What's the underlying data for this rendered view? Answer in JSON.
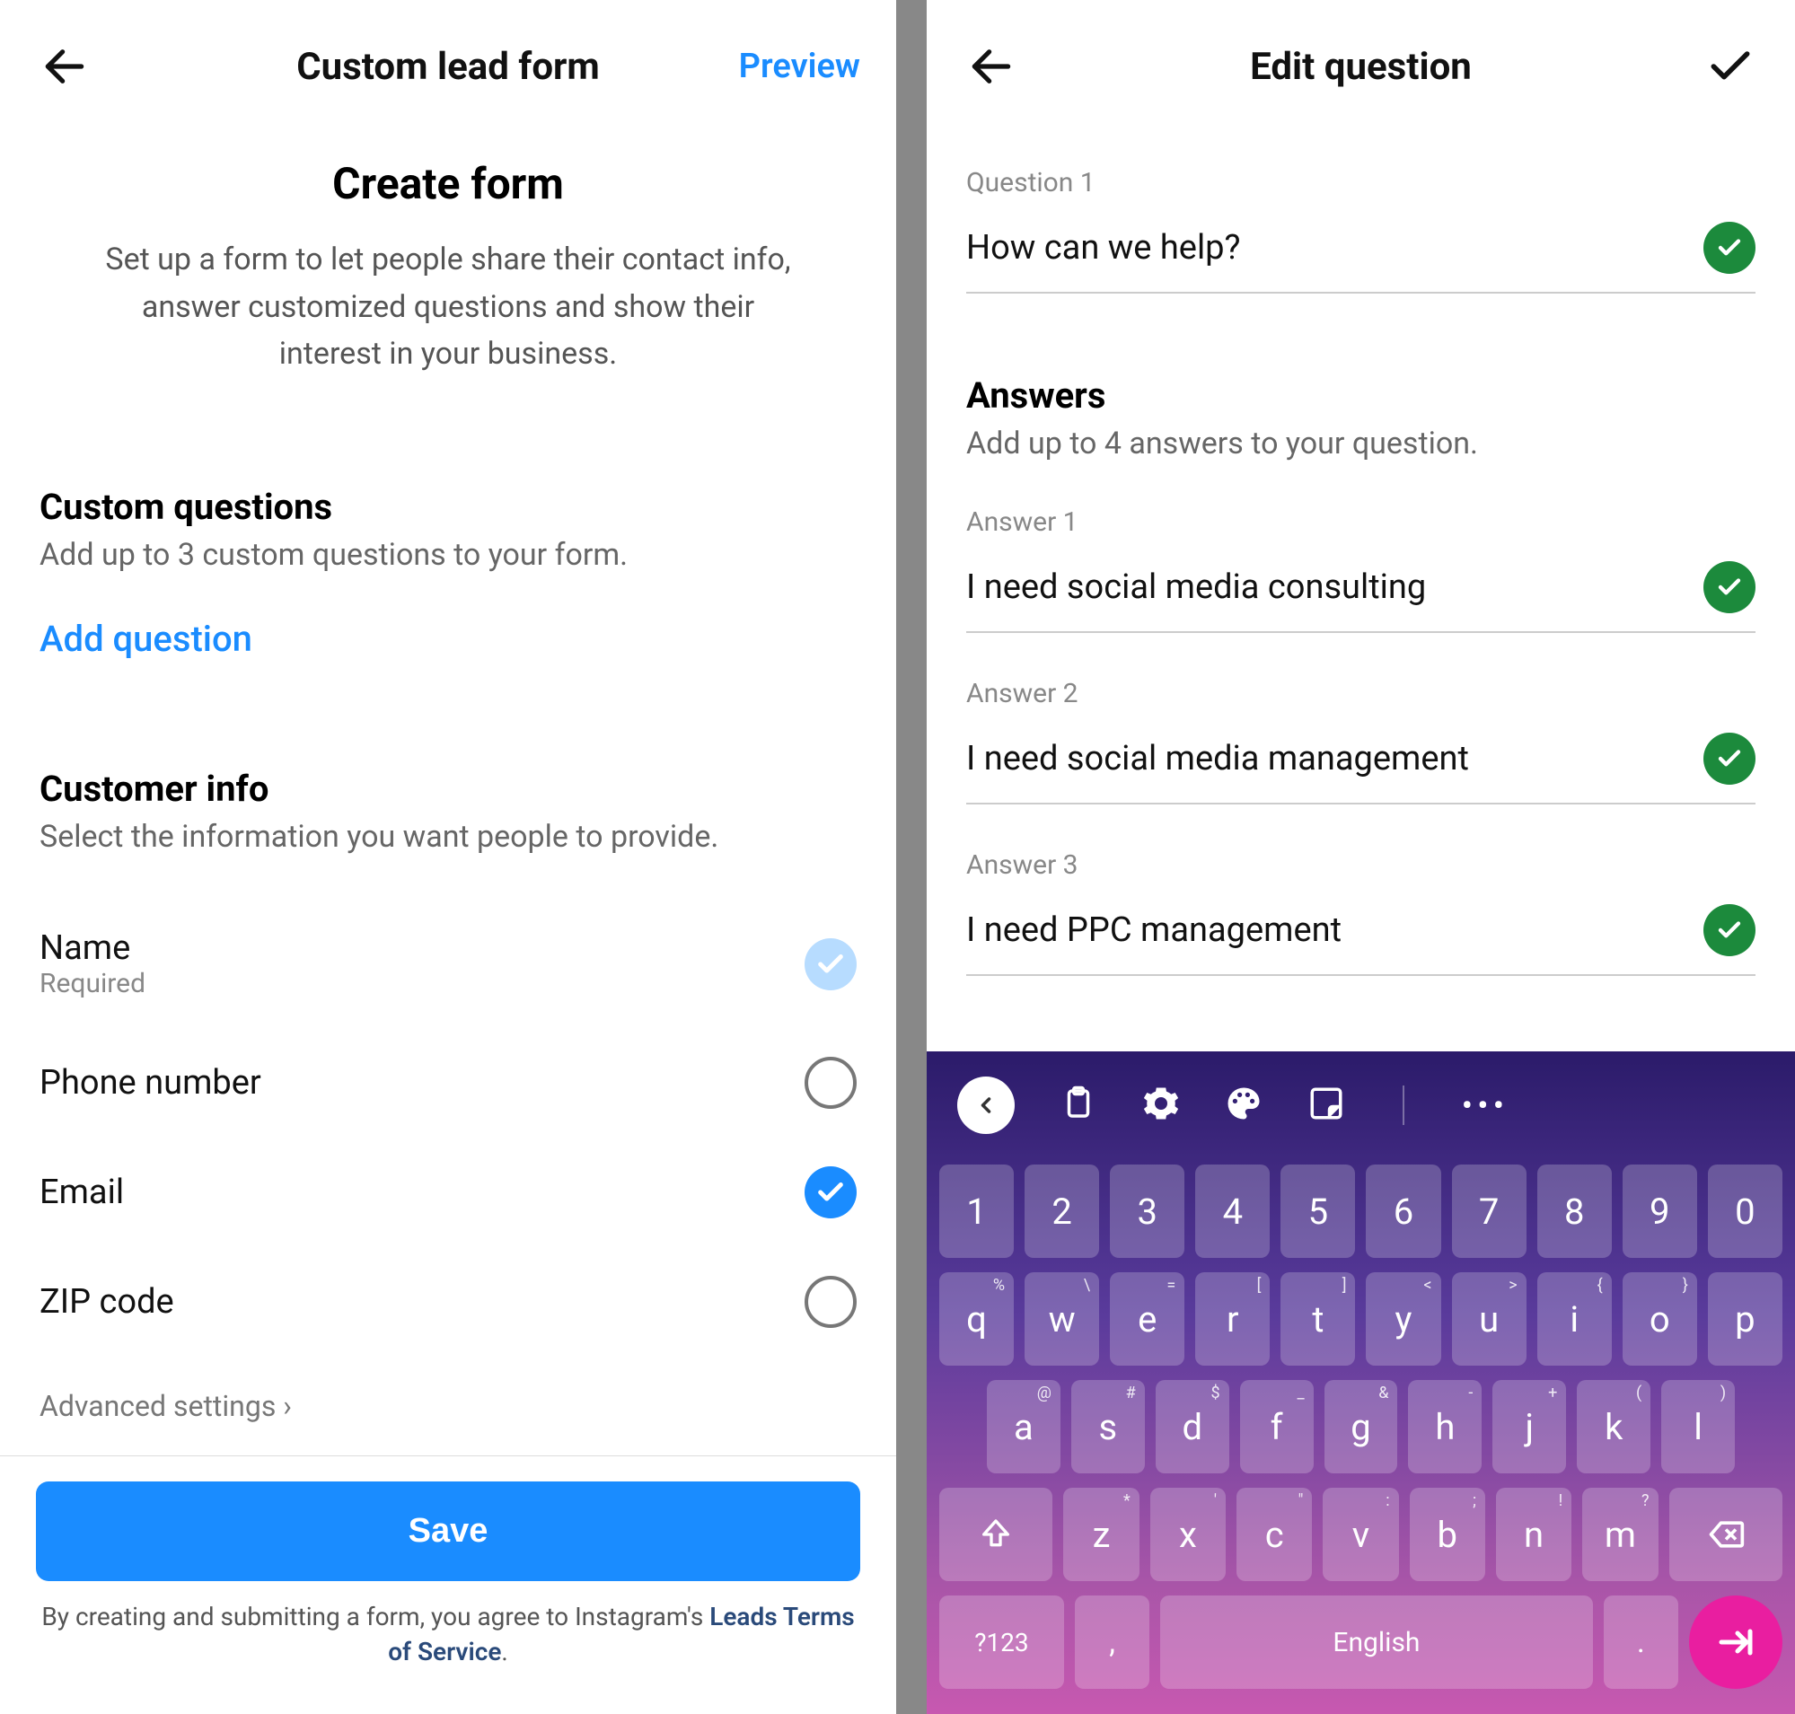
{
  "left": {
    "header": {
      "title": "Custom lead form",
      "preview": "Preview"
    },
    "main_title": "Create form",
    "subtitle": "Set up a form to let people share their contact info, answer customized questions and show their interest in your business.",
    "custom_q_title": "Custom questions",
    "custom_q_sub": "Add up to 3 custom questions to your form.",
    "add_question": "Add question",
    "customer_info_title": "Customer info",
    "customer_info_sub": "Select the information you want people to provide.",
    "fields": {
      "name": {
        "label": "Name",
        "sub": "Required"
      },
      "phone": {
        "label": "Phone number"
      },
      "email": {
        "label": "Email"
      },
      "zip": {
        "label": "ZIP code"
      }
    },
    "advanced": "Advanced settings",
    "save": "Save",
    "legal_pre": "By creating and submitting a form, you agree to Instagram's ",
    "legal_link": "Leads Terms of Service",
    "legal_post": "."
  },
  "right": {
    "header": {
      "title": "Edit question"
    },
    "q1_label": "Question 1",
    "q1_value": "How can we help?",
    "answers_title": "Answers",
    "answers_sub": "Add up to 4 answers to your question.",
    "a1_label": "Answer 1",
    "a1_value": "I need social media consulting",
    "a2_label": "Answer 2",
    "a2_value": "I need social media management",
    "a3_label": "Answer 3",
    "a3_value": "I need PPC management",
    "keyboard": {
      "row1": [
        "1",
        "2",
        "3",
        "4",
        "5",
        "6",
        "7",
        "8",
        "9",
        "0"
      ],
      "row2": [
        {
          "k": "q",
          "s": "%"
        },
        {
          "k": "w",
          "s": "\\"
        },
        {
          "k": "e",
          "s": "="
        },
        {
          "k": "r",
          "s": "["
        },
        {
          "k": "t",
          "s": "]"
        },
        {
          "k": "y",
          "s": "<"
        },
        {
          "k": "u",
          "s": ">"
        },
        {
          "k": "i",
          "s": "{"
        },
        {
          "k": "o",
          "s": "}"
        },
        {
          "k": "p",
          "s": ""
        }
      ],
      "row3": [
        {
          "k": "a",
          "s": "@"
        },
        {
          "k": "s",
          "s": "#"
        },
        {
          "k": "d",
          "s": "$"
        },
        {
          "k": "f",
          "s": "_"
        },
        {
          "k": "g",
          "s": "&"
        },
        {
          "k": "h",
          "s": "-"
        },
        {
          "k": "j",
          "s": "+"
        },
        {
          "k": "k",
          "s": "("
        },
        {
          "k": "l",
          "s": ")"
        }
      ],
      "row4": [
        {
          "k": "z",
          "s": "*"
        },
        {
          "k": "x",
          "s": "'"
        },
        {
          "k": "c",
          "s": "\""
        },
        {
          "k": "v",
          "s": ":"
        },
        {
          "k": "b",
          "s": ";"
        },
        {
          "k": "n",
          "s": "!"
        },
        {
          "k": "m",
          "s": "?"
        }
      ],
      "mode_key": "?123",
      "space": "English",
      "period": "."
    }
  }
}
